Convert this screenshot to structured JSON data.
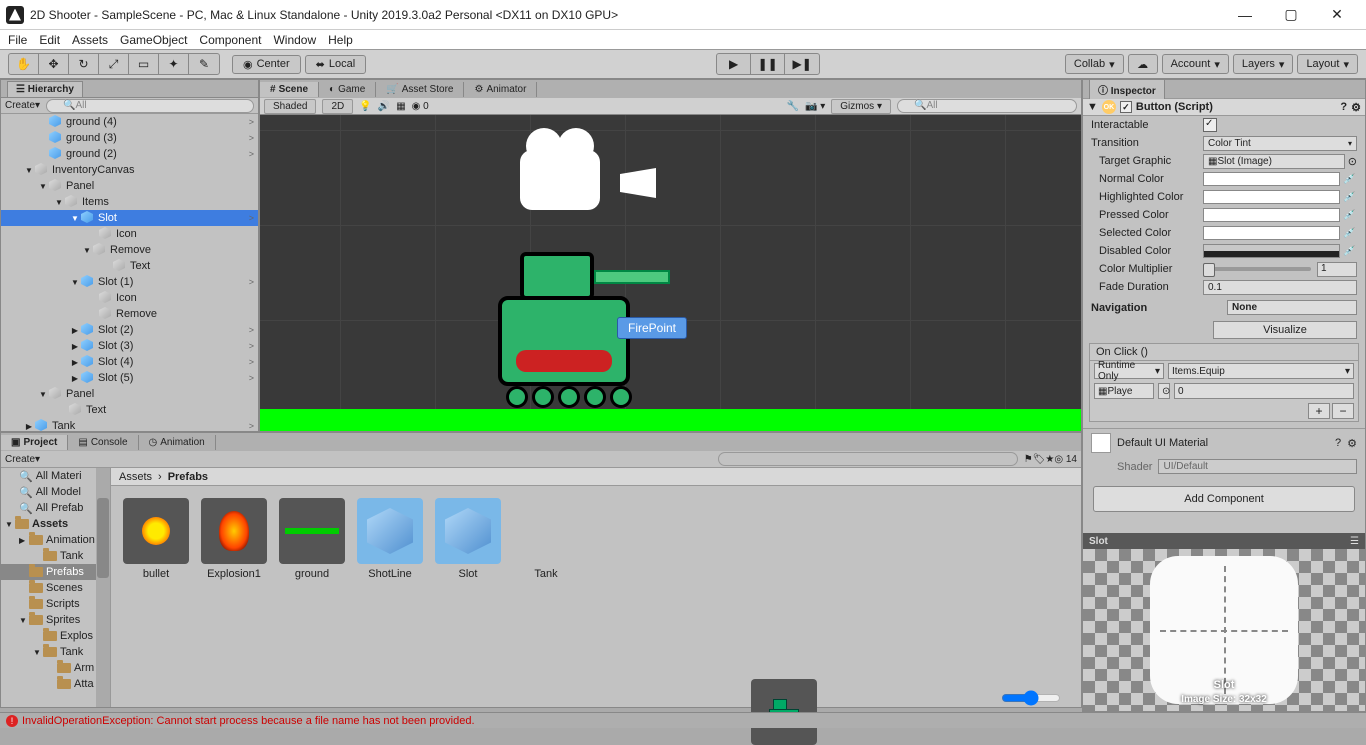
{
  "title": "2D Shooter - SampleScene - PC, Mac & Linux Standalone - Unity 2019.3.0a2 Personal <DX11 on DX10 GPU>",
  "menus": [
    "File",
    "Edit",
    "Assets",
    "GameObject",
    "Component",
    "Window",
    "Help"
  ],
  "toolbar": {
    "pivot1": "Center",
    "pivot2": "Local",
    "collab": "Collab",
    "account": "Account",
    "layers": "Layers",
    "layout": "Layout"
  },
  "hierarchy": {
    "title": "Hierarchy",
    "create": "Create",
    "search_placeholder": "All",
    "items": [
      {
        "pad": 36,
        "fold": "",
        "icon": "blue",
        "label": "ground (4)",
        "arr": ">"
      },
      {
        "pad": 36,
        "fold": "",
        "icon": "blue",
        "label": "ground (3)",
        "arr": ">"
      },
      {
        "pad": 36,
        "fold": "",
        "icon": "blue",
        "label": "ground (2)",
        "arr": ">"
      },
      {
        "pad": 22,
        "fold": "▼",
        "icon": "gray",
        "label": "InventoryCanvas"
      },
      {
        "pad": 36,
        "fold": "▼",
        "icon": "gray",
        "label": "Panel"
      },
      {
        "pad": 52,
        "fold": "▼",
        "icon": "gray",
        "label": "Items"
      },
      {
        "pad": 68,
        "fold": "▼",
        "icon": "blue",
        "label": "Slot",
        "sel": true,
        "arr": ">"
      },
      {
        "pad": 86,
        "fold": "",
        "icon": "gray",
        "label": "Icon"
      },
      {
        "pad": 80,
        "fold": "▼",
        "icon": "gray",
        "label": "Remove"
      },
      {
        "pad": 100,
        "fold": "",
        "icon": "gray",
        "label": "Text"
      },
      {
        "pad": 68,
        "fold": "▼",
        "icon": "blue",
        "label": "Slot (1)",
        "arr": ">"
      },
      {
        "pad": 86,
        "fold": "",
        "icon": "gray",
        "label": "Icon"
      },
      {
        "pad": 86,
        "fold": "",
        "icon": "gray",
        "label": "Remove"
      },
      {
        "pad": 68,
        "fold": "▶",
        "icon": "blue",
        "label": "Slot (2)",
        "arr": ">"
      },
      {
        "pad": 68,
        "fold": "▶",
        "icon": "blue",
        "label": "Slot (3)",
        "arr": ">"
      },
      {
        "pad": 68,
        "fold": "▶",
        "icon": "blue",
        "label": "Slot (4)",
        "arr": ">"
      },
      {
        "pad": 68,
        "fold": "▶",
        "icon": "blue",
        "label": "Slot (5)",
        "arr": ">"
      },
      {
        "pad": 36,
        "fold": "▼",
        "icon": "gray",
        "label": "Panel"
      },
      {
        "pad": 56,
        "fold": "",
        "icon": "gray",
        "label": "Text"
      },
      {
        "pad": 22,
        "fold": "▶",
        "icon": "blue",
        "label": "Tank",
        "arr": ">"
      }
    ]
  },
  "scene": {
    "tabs": [
      "Scene",
      "Game",
      "Asset Store",
      "Animator"
    ],
    "shaded": "Shaded",
    "mode2d": "2D",
    "gizmos": "Gizmos",
    "search_placeholder": "All",
    "mip": "0",
    "firepoint": "FirePoint"
  },
  "project": {
    "tabs": [
      "Project",
      "Console",
      "Animation"
    ],
    "create": "Create",
    "count": "14",
    "breadcrumbs": [
      "Assets",
      "Prefabs"
    ],
    "folders": [
      {
        "pad": 18,
        "label": "All Materi",
        "q": true
      },
      {
        "pad": 18,
        "label": "All Model",
        "q": true
      },
      {
        "pad": 18,
        "label": "All Prefab",
        "q": true
      },
      {
        "pad": 4,
        "label": "Assets",
        "hl": true,
        "fold": "▼"
      },
      {
        "pad": 18,
        "label": "Animation",
        "fold": "▶"
      },
      {
        "pad": 32,
        "label": "Tank"
      },
      {
        "pad": 18,
        "label": "Prefabs",
        "sel": true
      },
      {
        "pad": 18,
        "label": "Scenes"
      },
      {
        "pad": 18,
        "label": "Scripts"
      },
      {
        "pad": 18,
        "label": "Sprites",
        "fold": "▼"
      },
      {
        "pad": 32,
        "label": "Explos"
      },
      {
        "pad": 32,
        "label": "Tank",
        "fold": "▼"
      },
      {
        "pad": 46,
        "label": "Arm"
      },
      {
        "pad": 46,
        "label": "Atta"
      }
    ],
    "assets": [
      {
        "name": "bullet",
        "t": "bullet"
      },
      {
        "name": "Explosion1",
        "t": "expl"
      },
      {
        "name": "ground",
        "t": "ground"
      },
      {
        "name": "ShotLine",
        "t": "pf"
      },
      {
        "name": "Slot",
        "t": "pf"
      },
      {
        "name": "Tank",
        "t": "tank"
      }
    ]
  },
  "inspector": {
    "title": "Inspector",
    "component": "Button (Script)",
    "interactable_label": "Interactable",
    "transition_label": "Transition",
    "transition_value": "Color Tint",
    "target_graphic_label": "Target Graphic",
    "target_graphic_value": "Slot (Image)",
    "normal_color": "Normal Color",
    "highlighted_color": "Highlighted Color",
    "pressed_color": "Pressed Color",
    "selected_color": "Selected Color",
    "disabled_color": "Disabled Color",
    "color_multiplier_label": "Color Multiplier",
    "color_multiplier_value": "1",
    "fade_duration_label": "Fade Duration",
    "fade_duration_value": "0.1",
    "navigation_label": "Navigation",
    "navigation_value": "None",
    "visualize": "Visualize",
    "onclick_label": "On Click ()",
    "runtime": "Runtime Only",
    "method": "Items.Equip",
    "player": "Playe",
    "arg": "0",
    "material": "Default UI Material",
    "shader_label": "Shader",
    "shader_value": "UI/Default",
    "add_component": "Add Component",
    "preview_name": "Slot",
    "preview_title": "Slot",
    "preview_size": "Image Size: 32x32"
  },
  "status": "InvalidOperationException: Cannot start process because a file name has not been provided."
}
